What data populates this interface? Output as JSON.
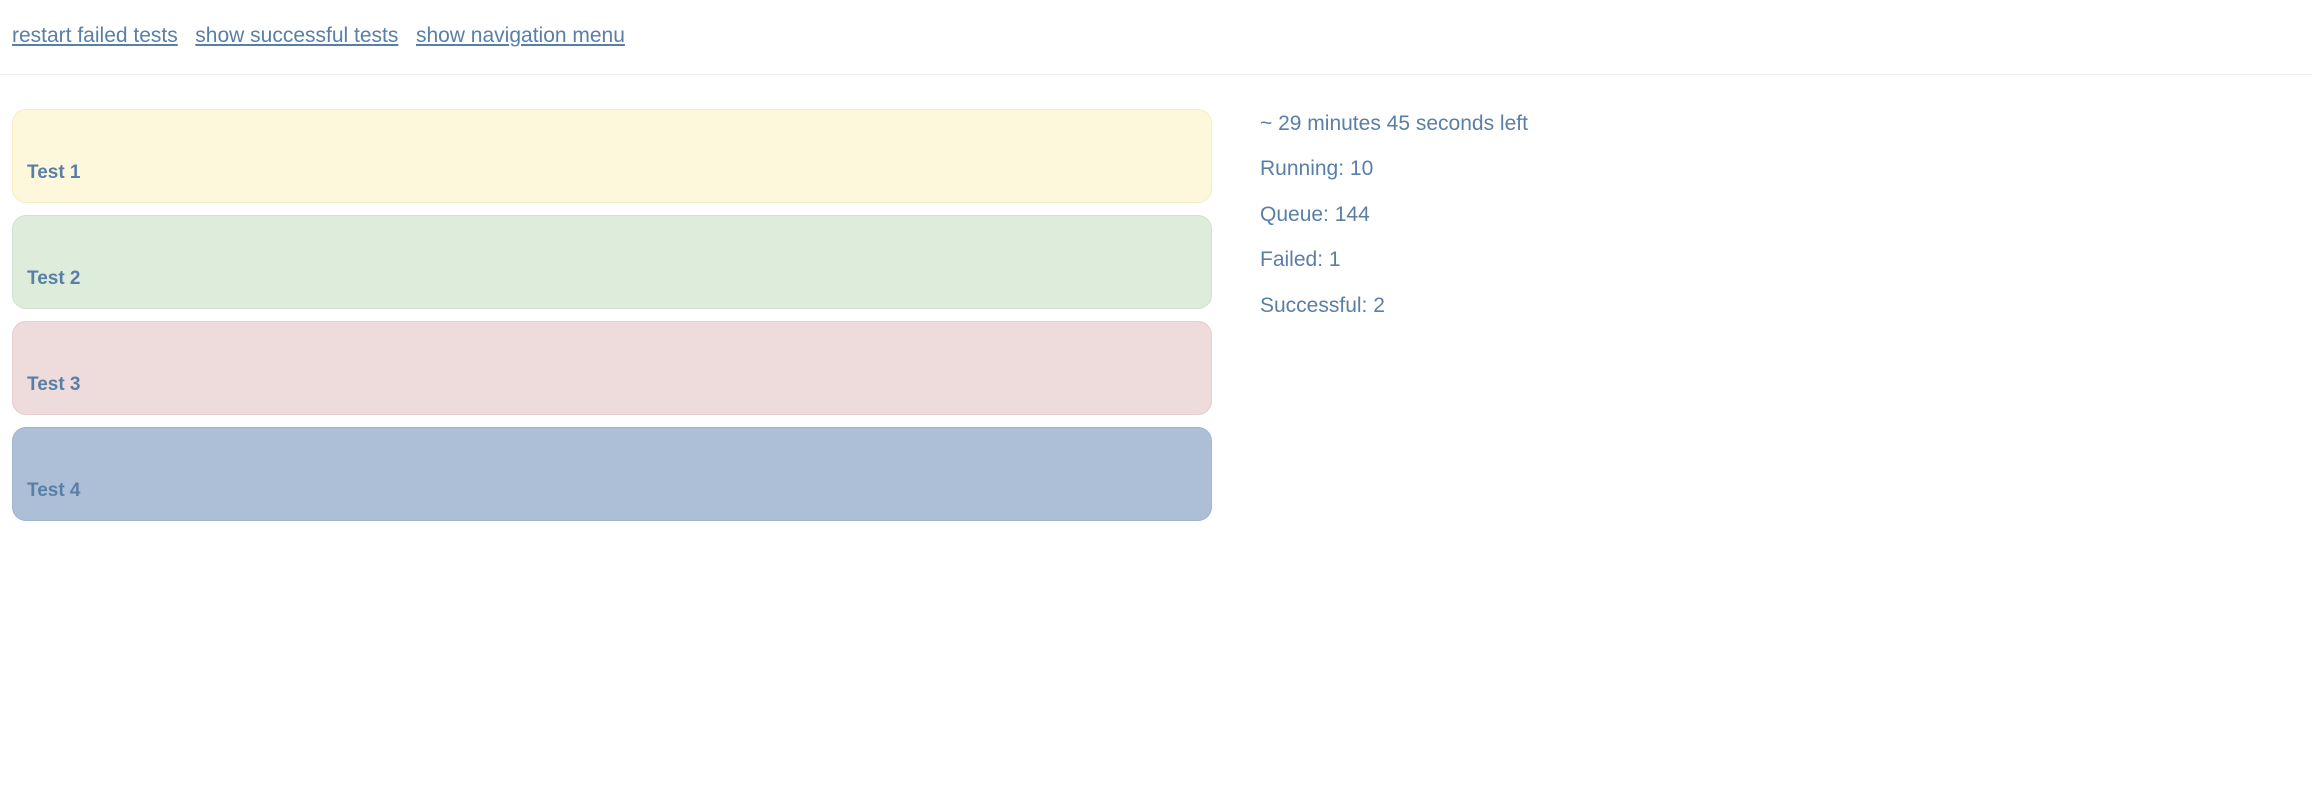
{
  "header": {
    "links": {
      "restart": "restart failed tests",
      "show_successful": "show successful tests",
      "show_nav": "show navigation menu"
    }
  },
  "tests": [
    {
      "label": "Test 1",
      "status": "running"
    },
    {
      "label": "Test 2",
      "status": "success"
    },
    {
      "label": "Test 3",
      "status": "failed"
    },
    {
      "label": "Test 4",
      "status": "queued"
    }
  ],
  "stats": {
    "time_left": "~ 29 minutes 45 seconds left",
    "running": "Running: 10",
    "queue": "Queue: 144",
    "failed": "Failed: 1",
    "successful": "Successful: 2"
  }
}
